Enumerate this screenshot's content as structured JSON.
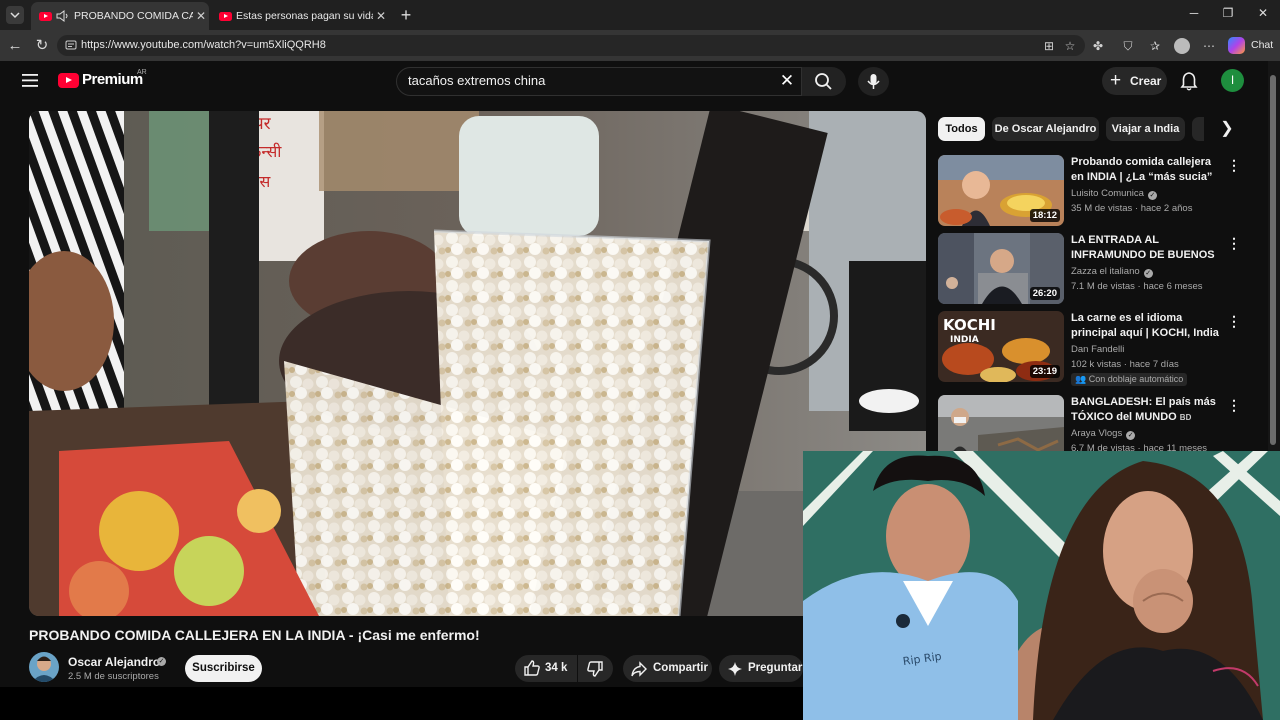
{
  "browser": {
    "tabs": [
      {
        "title": "PROBANDO COMIDA CALLEJERA EN LA INDIA",
        "active": true,
        "audio": true
      },
      {
        "title": "Estas personas pagan su vida con",
        "active": false,
        "audio": false
      }
    ],
    "url": "https://www.youtube.com/watch?v=um5XliQQRH8",
    "chat_label": "Chat"
  },
  "masthead": {
    "logo": "Premium",
    "country": "AR",
    "search_value": "tacaños extremos china",
    "create_label": "Crear",
    "avatar_letter": "I"
  },
  "video": {
    "title": "PROBANDO COMIDA CALLEJERA EN LA INDIA - ¡Casi me enfermo!",
    "channel": "Oscar Alejandro",
    "subscribers": "2.5 M de suscriptores",
    "subscribe_label": "Suscribirse",
    "likes": "34 k",
    "share_label": "Compartir",
    "ask_label": "Preguntar",
    "overlay_signs": [
      "पर",
      "फेन्सी",
      "ड्रेस"
    ]
  },
  "chips": [
    "Todos",
    "De Oscar Alejandro",
    "Viajar a India"
  ],
  "recommendations": [
    {
      "title": "Probando comida callejera en INDIA | ¿La “más sucia” del ...",
      "channel": "Luisito Comunica",
      "verified": true,
      "meta": "35 M de vistas · hace 2 años",
      "duration": "18:12",
      "badge": ""
    },
    {
      "title": "LA ENTRADA AL INFRAMUNDO DE BUENOS AIRES - ¡Aquí NO ...",
      "channel": "Zazza el italiano",
      "verified": true,
      "meta": "7.1 M de vistas · hace 6 meses",
      "duration": "26:20",
      "badge": ""
    },
    {
      "title": "La carne es el idioma principal aquí | KOCHI, India",
      "channel": "Dan Fandelli",
      "verified": false,
      "meta": "102 k vistas · hace 7 días",
      "duration": "23:19",
      "badge": "Con doblaje automático",
      "thumb_text": [
        "KOCHI",
        "INDIA"
      ]
    },
    {
      "title": "BANGLADESH: El país más TÓXICO del MUNDO",
      "title_suffix": "BD",
      "channel": "Araya Vlogs",
      "verified": true,
      "meta": "6.7 M de vistas · hace 11 meses",
      "duration": "",
      "badge": ""
    }
  ],
  "webcam": {
    "shirt_text": "Rip Rip"
  },
  "colors": {
    "brand_red": "#ff0033",
    "background": "#0f0f0f",
    "avatar_green": "#1e8e3e"
  }
}
